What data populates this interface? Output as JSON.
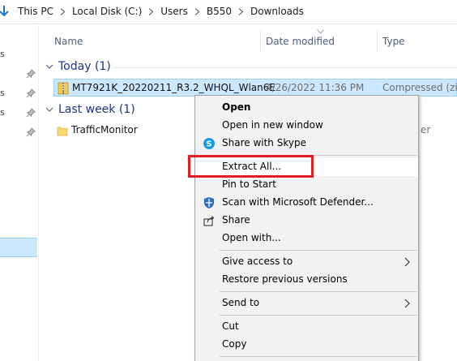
{
  "breadcrumb": {
    "items": [
      "This PC",
      "Local Disk (C:)",
      "Users",
      "B550",
      "Downloads"
    ]
  },
  "navpane": {
    "fragments": [
      "s",
      "s",
      "s"
    ]
  },
  "columns": {
    "name": "Name",
    "date_modified": "Date modified",
    "type": "Type"
  },
  "groups": [
    {
      "label": "Today (1)",
      "files": [
        {
          "name": "MT7921K_20220211_R3.2_WHQL_Wlan6E",
          "date": "4/26/2022 11:36 PM",
          "type": "Compressed (zipp",
          "icon": "zip-folder-icon",
          "selected": true
        }
      ]
    },
    {
      "label": "Last week (1)",
      "files": [
        {
          "name": "TrafficMonitor",
          "date": "",
          "type": "er",
          "icon": "folder-icon",
          "selected": false
        }
      ]
    }
  ],
  "context_menu": {
    "items": [
      {
        "label": "Open",
        "bold": true
      },
      {
        "label": "Open in new window"
      },
      {
        "label": "Share with Skype",
        "icon": "skype-icon"
      },
      {
        "label": "Extract All...",
        "highlighted": true
      },
      {
        "label": "Pin to Start"
      },
      {
        "label": "Scan with Microsoft Defender...",
        "icon": "defender-icon"
      },
      {
        "label": "Share",
        "icon": "share-icon"
      },
      {
        "label": "Open with..."
      },
      {
        "label": "Give access to",
        "submenu": true
      },
      {
        "label": "Restore previous versions"
      },
      {
        "label": "Send to",
        "submenu": true
      },
      {
        "label": "Cut"
      },
      {
        "label": "Copy"
      }
    ]
  },
  "colors": {
    "selection_bg": "#cce8ff",
    "selection_border": "#99d1ff",
    "group_label": "#1e3287",
    "highlight_box": "#e51e25",
    "menu_bg": "#f2f2f2"
  }
}
